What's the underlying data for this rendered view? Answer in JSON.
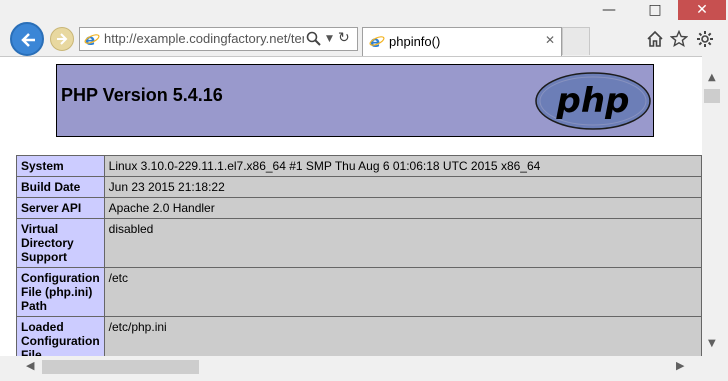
{
  "browser": {
    "url": "http://example.codingfactory.net/tem",
    "tab_title": "phpinfo()",
    "window_controls": {
      "minimize": "—",
      "maximize": "□",
      "close": "✕"
    }
  },
  "page": {
    "header_title": "PHP Version 5.4.16",
    "logo_text": "php",
    "rows": [
      {
        "key": "System",
        "value": "Linux           3.10.0-229.11.1.el7.x86_64 #1 SMP Thu Aug 6 01:06:18 UTC 2015 x86_64"
      },
      {
        "key": "Build Date",
        "value": "Jun 23 2015 21:18:22"
      },
      {
        "key": "Server API",
        "value": "Apache 2.0 Handler"
      },
      {
        "key": "Virtual Directory Support",
        "value": "disabled"
      },
      {
        "key": "Configuration File (php.ini) Path",
        "value": "/etc"
      },
      {
        "key": "Loaded Configuration File",
        "value": "/etc/php.ini"
      }
    ]
  }
}
